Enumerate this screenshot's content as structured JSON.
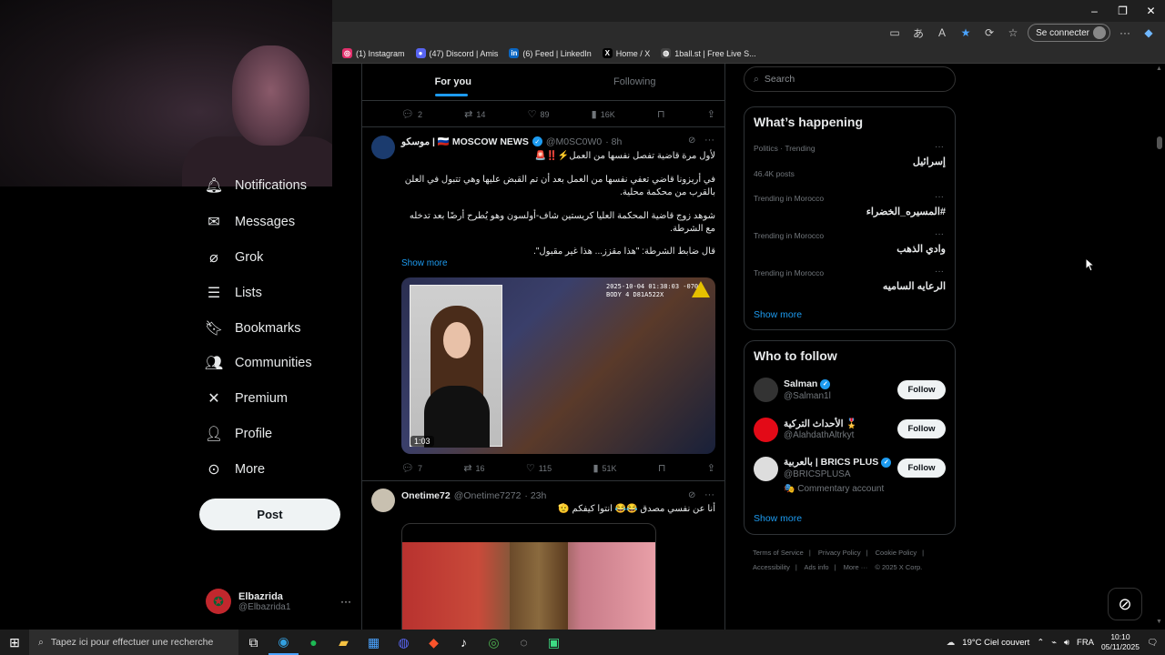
{
  "browser": {
    "signin_label": "Se connecter",
    "bookmarks": [
      {
        "label": "(1) Instagram",
        "icon": "instagram-icon",
        "color": "#e1306c"
      },
      {
        "label": "(47) Discord | Amis",
        "icon": "discord-icon",
        "color": "#5865f2"
      },
      {
        "label": "(6) Feed | LinkedIn",
        "icon": "linkedin-icon",
        "color": "#0a66c2"
      },
      {
        "label": "Home / X",
        "icon": "x-icon",
        "color": "#000000"
      },
      {
        "label": "1ball.st | Free Live S...",
        "icon": "globe-icon",
        "color": "#666666"
      }
    ]
  },
  "nav": {
    "items": [
      {
        "label": "Notifications",
        "icon": "bell-icon"
      },
      {
        "label": "Messages",
        "icon": "mail-icon"
      },
      {
        "label": "Grok",
        "icon": "grok-icon"
      },
      {
        "label": "Lists",
        "icon": "list-icon"
      },
      {
        "label": "Bookmarks",
        "icon": "bookmark-icon"
      },
      {
        "label": "Communities",
        "icon": "communities-icon"
      },
      {
        "label": "Premium",
        "icon": "x-icon"
      },
      {
        "label": "Profile",
        "icon": "person-icon"
      },
      {
        "label": "More",
        "icon": "more-circle-icon"
      }
    ],
    "post_label": "Post",
    "user": {
      "name": "Elbazrida",
      "handle": "@Elbazrida1"
    }
  },
  "timeline": {
    "tabs": [
      "For you",
      "Following"
    ],
    "top_actions": {
      "replies": "2",
      "reposts": "14",
      "likes": "89",
      "views": "16K"
    },
    "tweet1": {
      "name": "موسكو | 🇷🇺 MOSCOW NEWS",
      "handle": "@M0SC0W0",
      "time": "· 8h",
      "line1": "لأول مرة قاضية تفصل نفسها من العمل⚡‼️🚨",
      "line2": "في أريزونا قاضي تعفي نفسها من العمل بعد أن تم القبض عليها وهي تتبول في العلن بالقرب من محكمة محلية.",
      "line3": "شوهد زوج قاضية المحكمة العليا كريستين شاف-أولسون وهو يُطرح أرضًا بعد تدخله مع الشرطة.",
      "line4": "قال ضابط الشرطة: \"هذا مقزز... هذا غير مقبول\".",
      "show_more": "Show more",
      "video_duration": "1:03",
      "video_stamp_1": "2025-10-04 01:38:03 -0700",
      "video_stamp_2": "BODY 4 D81A522X",
      "actions": {
        "replies": "7",
        "reposts": "16",
        "likes": "115",
        "views": "51K"
      }
    },
    "tweet2": {
      "name": "Onetime72",
      "handle": "@Onetime7272",
      "time": "· 23h",
      "text": "أنا عن نفسي مصدق 😂😂 انتوا كيفكم 🫡"
    }
  },
  "sidebar": {
    "search_placeholder": "Search",
    "happening": {
      "title": "What’s happening",
      "trends": [
        {
          "category": "Politics · Trending",
          "name": "إسرائيل",
          "posts": "46.4K posts"
        },
        {
          "category": "Trending in Morocco",
          "name": "#المسيره_الخضراء",
          "posts": ""
        },
        {
          "category": "Trending in Morocco",
          "name": "وادي الذهب",
          "posts": ""
        },
        {
          "category": "Trending in Morocco",
          "name": "الرعايه الساميه",
          "posts": ""
        }
      ],
      "show_more": "Show more"
    },
    "who_to_follow": {
      "title": "Who to follow",
      "users": [
        {
          "name": "Salman",
          "handle": "@Salman1l",
          "extra": "",
          "follow": "Follow"
        },
        {
          "name": "الأحداث التركية 🎖️",
          "handle": "@AlahdathAltrkyt",
          "extra": "",
          "follow": "Follow"
        },
        {
          "name": "بالعربية | BRICS PLUS",
          "handle": "@BRICSPLUSA",
          "extra": "🎭 Commentary account",
          "follow": "Follow"
        }
      ],
      "show_more": "Show more"
    },
    "footer": [
      "Terms of Service",
      "|",
      "Privacy Policy",
      "|",
      "Cookie Policy",
      "|",
      "Accessibility",
      "|",
      "Ads info",
      "|",
      "More ···",
      "© 2025 X Corp."
    ]
  },
  "taskbar": {
    "search_placeholder": "Tapez ici pour effectuer une recherche",
    "weather": "19°C  Ciel couvert",
    "lang": "FRA",
    "time": "10:10",
    "date": "05/11/2025"
  }
}
